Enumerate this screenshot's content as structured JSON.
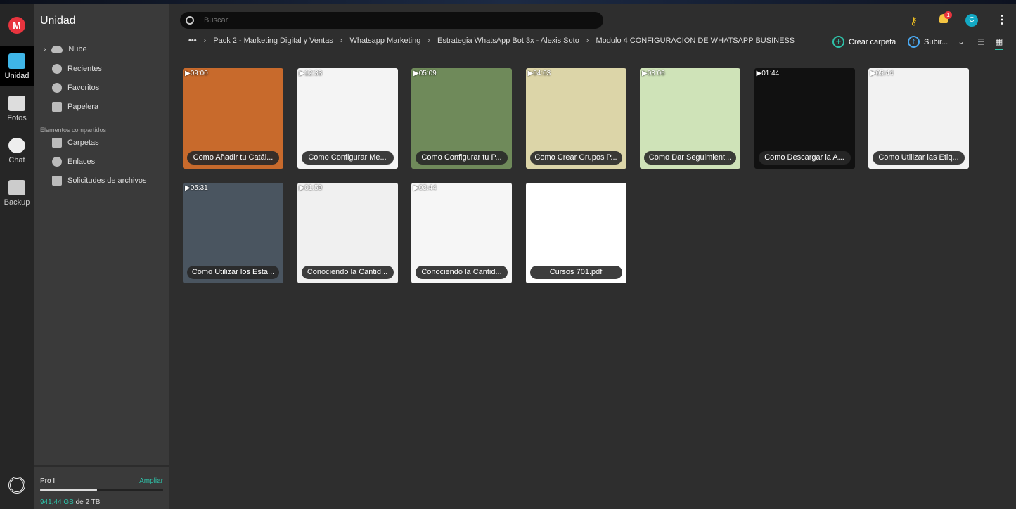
{
  "rail": {
    "items": [
      {
        "label": "Unidad",
        "icon": "folder-icon"
      },
      {
        "label": "Fotos",
        "icon": "photo-icon"
      },
      {
        "label": "Chat",
        "icon": "chat-icon"
      },
      {
        "label": "Backup",
        "icon": "backup-icon"
      }
    ]
  },
  "sidebar": {
    "title": "Unidad",
    "items": [
      {
        "label": "Nube"
      },
      {
        "label": "Recientes"
      },
      {
        "label": "Favoritos"
      },
      {
        "label": "Papelera"
      }
    ],
    "shared_title": "Elementos compartidos",
    "shared": [
      {
        "label": "Carpetas"
      },
      {
        "label": "Enlaces"
      },
      {
        "label": "Solicitudes de archivos"
      }
    ],
    "storage": {
      "plan": "Pro I",
      "upgrade": "Ampliar",
      "used": "941,44 GB",
      "of": "de 2 TB",
      "fraction": 0.46
    }
  },
  "search": {
    "placeholder": "Buscar"
  },
  "header": {
    "notification_count": "1",
    "avatar": "C"
  },
  "breadcrumb": [
    "Pack 2 - Marketing Digital y Ventas",
    "Whatsapp Marketing",
    "Estrategia WhatsApp Bot 3x - Alexis Soto",
    "Modulo 4 CONFIGURACION DE WHATSAPP BUSINESS"
  ],
  "toolbar": {
    "create_folder": "Crear carpeta",
    "upload": "Subir..."
  },
  "colors": {
    "accent": "#2fc1a8",
    "brand": "#e8343e"
  },
  "files": [
    {
      "name": "Como Añadir tu Catál...",
      "duration": "09:00",
      "color": "#c86a2c"
    },
    {
      "name": "Como Configurar Me...",
      "duration": "12:33",
      "color": "#f4f4f4"
    },
    {
      "name": "Como Configurar tu P...",
      "duration": "05:09",
      "color": "#6f8a5a"
    },
    {
      "name": "Como Crear Grupos P...",
      "duration": "04:03",
      "color": "#dcd5a8"
    },
    {
      "name": "Como Dar Seguimient...",
      "duration": "03:06",
      "color": "#cfe3b8"
    },
    {
      "name": "Como Descargar la A...",
      "duration": "01:44",
      "color": "#111111"
    },
    {
      "name": "Como Utilizar las Etiq...",
      "duration": "05:44",
      "color": "#f2f2f2"
    },
    {
      "name": "Como Utilizar los Esta...",
      "duration": "05:31",
      "color": "#4a5560"
    },
    {
      "name": "Conociendo la Cantid...",
      "duration": "01:59",
      "color": "#f0f0f0"
    },
    {
      "name": "Conociendo la Cantid...",
      "duration": "03:44",
      "color": "#f6f6f6"
    },
    {
      "name": "Cursos 701.pdf",
      "duration": "",
      "color": "#ffffff"
    }
  ]
}
